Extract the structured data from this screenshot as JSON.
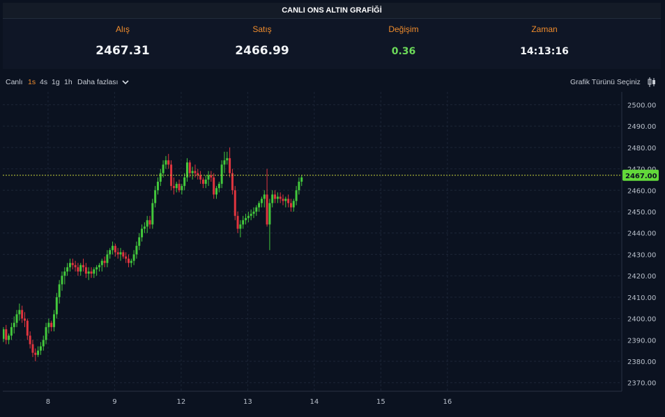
{
  "header": {
    "title": "CANLI ONS ALTIN GRAFİĞİ"
  },
  "stats": {
    "bid_label": "Alış",
    "bid_value": "2467.31",
    "ask_label": "Satış",
    "ask_value": "2466.99",
    "change_label": "Değişim",
    "change_value": "0.36",
    "time_label": "Zaman",
    "time_value": "14:13:16"
  },
  "toolbar": {
    "live_label": "Canlı",
    "intervals": [
      "1s",
      "4s",
      "1g",
      "1h"
    ],
    "active_interval": "1s",
    "more_label": "Daha fazlası",
    "chart_type_label": "Grafik Türünü Seçiniz"
  },
  "colors": {
    "up": "#43c83c",
    "down": "#e0353f",
    "accent": "#f08c2c",
    "price_tag": "#62d93a",
    "background": "#0b1220"
  },
  "chart_data": {
    "type": "candlestick",
    "ylim": [
      2366,
      2506
    ],
    "yticks": [
      "2370.00",
      "2380.00",
      "2390.00",
      "2400.00",
      "2410.00",
      "2420.00",
      "2430.00",
      "2440.00",
      "2450.00",
      "2460.00",
      "2470.00",
      "2480.00",
      "2490.00",
      "2500.00"
    ],
    "xlim": [
      7.32,
      16.62
    ],
    "xticks": [
      {
        "label": "8",
        "x": 8
      },
      {
        "label": "9",
        "x": 9
      },
      {
        "label": "12",
        "x": 10
      },
      {
        "label": "13",
        "x": 11
      },
      {
        "label": "14",
        "x": 12
      },
      {
        "label": "15",
        "x": 13
      },
      {
        "label": "16",
        "x": 14
      }
    ],
    "last_price": 2467.0,
    "last_price_label": "2467.00",
    "grid": true,
    "candles": [
      [
        7.33,
        2390.5,
        2396,
        2389,
        2395
      ],
      [
        7.37,
        2395,
        2397,
        2388,
        2390
      ],
      [
        7.41,
        2390,
        2393,
        2388,
        2392
      ],
      [
        7.45,
        2392,
        2398,
        2390,
        2396
      ],
      [
        7.49,
        2396,
        2401,
        2393,
        2398
      ],
      [
        7.53,
        2398,
        2404,
        2396,
        2402
      ],
      [
        7.57,
        2402,
        2407,
        2399,
        2404
      ],
      [
        7.61,
        2404,
        2406,
        2398,
        2400
      ],
      [
        7.65,
        2400,
        2403,
        2396,
        2399
      ],
      [
        7.69,
        2399,
        2400,
        2390,
        2392
      ],
      [
        7.73,
        2392,
        2394,
        2386,
        2388
      ],
      [
        7.77,
        2388,
        2390,
        2382,
        2384
      ],
      [
        7.81,
        2384,
        2386,
        2380,
        2383
      ],
      [
        7.85,
        2383,
        2387,
        2382,
        2385
      ],
      [
        7.89,
        2385,
        2389,
        2383,
        2387
      ],
      [
        7.93,
        2387,
        2392,
        2385,
        2390
      ],
      [
        7.97,
        2390,
        2398,
        2388,
        2396
      ],
      [
        8.01,
        2396,
        2400,
        2393,
        2398
      ],
      [
        8.05,
        2398,
        2399,
        2394,
        2396
      ],
      [
        8.09,
        2396,
        2404,
        2394,
        2402
      ],
      [
        8.13,
        2402,
        2412,
        2400,
        2410
      ],
      [
        8.17,
        2410,
        2418,
        2407,
        2416
      ],
      [
        8.21,
        2416,
        2422,
        2413,
        2420
      ],
      [
        8.25,
        2420,
        2424,
        2416,
        2422
      ],
      [
        8.29,
        2422,
        2426,
        2420,
        2424
      ],
      [
        8.33,
        2424,
        2428,
        2422,
        2426
      ],
      [
        8.37,
        2426,
        2428,
        2423,
        2425
      ],
      [
        8.41,
        2425,
        2427,
        2422,
        2424
      ],
      [
        8.45,
        2424,
        2426,
        2420,
        2422
      ],
      [
        8.49,
        2422,
        2426,
        2420,
        2425
      ],
      [
        8.53,
        2425,
        2428,
        2422,
        2424
      ],
      [
        8.57,
        2424,
        2426,
        2419,
        2421
      ],
      [
        8.61,
        2421,
        2424,
        2418,
        2422
      ],
      [
        8.65,
        2422,
        2424,
        2419,
        2421
      ],
      [
        8.69,
        2421,
        2424,
        2419,
        2423
      ],
      [
        8.73,
        2423,
        2425,
        2420,
        2424
      ],
      [
        8.77,
        2424,
        2426,
        2422,
        2425
      ],
      [
        8.81,
        2425,
        2428,
        2422,
        2427
      ],
      [
        8.85,
        2427,
        2429,
        2424,
        2426
      ],
      [
        8.89,
        2426,
        2432,
        2424,
        2430
      ],
      [
        8.93,
        2430,
        2433,
        2428,
        2432
      ],
      [
        8.97,
        2432,
        2436,
        2430,
        2434
      ],
      [
        9.01,
        2434,
        2435,
        2429,
        2431
      ],
      [
        9.05,
        2431,
        2433,
        2428,
        2430
      ],
      [
        9.09,
        2430,
        2433,
        2427,
        2431
      ],
      [
        9.13,
        2431,
        2432,
        2428,
        2429
      ],
      [
        9.17,
        2429,
        2431,
        2426,
        2428
      ],
      [
        9.21,
        2428,
        2430,
        2424,
        2426
      ],
      [
        9.25,
        2426,
        2428,
        2424,
        2427
      ],
      [
        9.29,
        2427,
        2432,
        2425,
        2430
      ],
      [
        9.33,
        2430,
        2436,
        2428,
        2434
      ],
      [
        9.37,
        2434,
        2440,
        2432,
        2438
      ],
      [
        9.41,
        2438,
        2444,
        2436,
        2442
      ],
      [
        9.45,
        2442,
        2445,
        2440,
        2443
      ],
      [
        9.49,
        2443,
        2448,
        2440,
        2446
      ],
      [
        9.53,
        2446,
        2448,
        2442,
        2444
      ],
      [
        9.57,
        2444,
        2456,
        2442,
        2454
      ],
      [
        9.61,
        2454,
        2462,
        2452,
        2460
      ],
      [
        9.65,
        2460,
        2466,
        2458,
        2464
      ],
      [
        9.69,
        2464,
        2470,
        2462,
        2468
      ],
      [
        9.73,
        2468,
        2474,
        2466,
        2472
      ],
      [
        9.77,
        2472,
        2476,
        2470,
        2474
      ],
      [
        9.81,
        2474,
        2477,
        2470,
        2472
      ],
      [
        9.85,
        2472,
        2474,
        2460,
        2462
      ],
      [
        9.89,
        2462,
        2466,
        2458,
        2461
      ],
      [
        9.93,
        2461,
        2464,
        2459,
        2463
      ],
      [
        9.97,
        2463,
        2465,
        2459,
        2460
      ],
      [
        10.01,
        2460,
        2463,
        2458,
        2462
      ],
      [
        10.05,
        2462,
        2468,
        2460,
        2466
      ],
      [
        10.09,
        2466,
        2475,
        2464,
        2473
      ],
      [
        10.13,
        2473,
        2474,
        2466,
        2468
      ],
      [
        10.17,
        2468,
        2471,
        2465,
        2469
      ],
      [
        10.21,
        2469,
        2472,
        2466,
        2468
      ],
      [
        10.25,
        2468,
        2470,
        2465,
        2467
      ],
      [
        10.29,
        2467,
        2469,
        2463,
        2465
      ],
      [
        10.33,
        2465,
        2466,
        2461,
        2463
      ],
      [
        10.37,
        2463,
        2467,
        2461,
        2465
      ],
      [
        10.41,
        2465,
        2469,
        2462,
        2467
      ],
      [
        10.45,
        2467,
        2469,
        2464,
        2466
      ],
      [
        10.49,
        2466,
        2468,
        2456,
        2458
      ],
      [
        10.53,
        2458,
        2462,
        2456,
        2461
      ],
      [
        10.57,
        2461,
        2464,
        2459,
        2463
      ],
      [
        10.61,
        2463,
        2474,
        2461,
        2472
      ],
      [
        10.65,
        2472,
        2478,
        2468,
        2474
      ],
      [
        10.69,
        2474,
        2478,
        2472,
        2475
      ],
      [
        10.73,
        2475,
        2480,
        2466,
        2468
      ],
      [
        10.77,
        2468,
        2470,
        2458,
        2460
      ],
      [
        10.81,
        2460,
        2462,
        2446,
        2448
      ],
      [
        10.85,
        2448,
        2450,
        2440,
        2442
      ],
      [
        10.89,
        2442,
        2446,
        2438,
        2444
      ],
      [
        10.93,
        2444,
        2448,
        2442,
        2446
      ],
      [
        10.97,
        2446,
        2449,
        2444,
        2447
      ],
      [
        11.01,
        2447,
        2450,
        2445,
        2448
      ],
      [
        11.05,
        2448,
        2451,
        2446,
        2449
      ],
      [
        11.09,
        2449,
        2452,
        2447,
        2450
      ],
      [
        11.13,
        2450,
        2453,
        2448,
        2452
      ],
      [
        11.17,
        2452,
        2455,
        2450,
        2454
      ],
      [
        11.21,
        2454,
        2457,
        2452,
        2456
      ],
      [
        11.25,
        2456,
        2460,
        2452,
        2458
      ],
      [
        11.29,
        2458,
        2470,
        2443,
        2444
      ],
      [
        11.33,
        2444,
        2456,
        2432,
        2454
      ],
      [
        11.37,
        2454,
        2460,
        2452,
        2458
      ],
      [
        11.41,
        2458,
        2460,
        2454,
        2456
      ],
      [
        11.45,
        2456,
        2459,
        2454,
        2457
      ],
      [
        11.49,
        2457,
        2459,
        2454,
        2456
      ],
      [
        11.53,
        2456,
        2458,
        2453,
        2455
      ],
      [
        11.57,
        2455,
        2457,
        2452,
        2456
      ],
      [
        11.61,
        2456,
        2458,
        2452,
        2454
      ],
      [
        11.65,
        2454,
        2456,
        2450,
        2452
      ],
      [
        11.69,
        2452,
        2456,
        2450,
        2455
      ],
      [
        11.73,
        2455,
        2462,
        2453,
        2460
      ],
      [
        11.77,
        2460,
        2466,
        2458,
        2464
      ],
      [
        11.81,
        2464,
        2467,
        2462,
        2466
      ]
    ]
  }
}
